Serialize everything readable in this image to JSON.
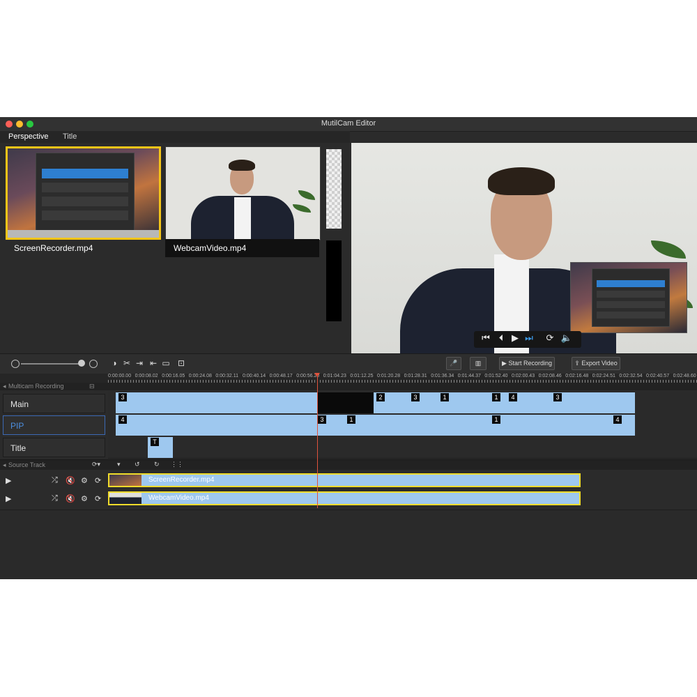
{
  "window": {
    "title": "MutilCam Editor"
  },
  "tabs": [
    {
      "label": "Perspective",
      "active": true
    },
    {
      "label": "Title",
      "active": false
    }
  ],
  "clips": [
    {
      "label": "ScreenRecorder.mp4",
      "selected": true
    },
    {
      "label": "WebcamVideo.mp4",
      "selected": false
    }
  ],
  "player": {
    "icons": [
      "skip-back-icon",
      "step-back-icon",
      "play-icon",
      "step-forward-icon",
      "loop-icon",
      "volume-icon"
    ]
  },
  "toolbar": {
    "tools": [
      "contrast-icon",
      "cut-icon",
      "split-left-icon",
      "split-right-icon",
      "crop-icon",
      "fit-icon"
    ],
    "start_recording_label": "Start Recording",
    "export_video_label": "Export Video"
  },
  "ruler": {
    "ticks": [
      "0:00:00.00",
      "0:00:08.02",
      "0:00:16.05",
      "0:00:24.08",
      "0:00:32.11",
      "0:00:40.14",
      "0:00:48.17",
      "0:00:56.20",
      "0:01:04.23",
      "0:01:12.25",
      "0:01:20.28",
      "0:01:28.31",
      "0:01:36.34",
      "0:01:44.37",
      "0:01:52.40",
      "0:02:00.43",
      "0:02:08.46",
      "0:02:16.48",
      "0:02:24.51",
      "0:02:32.54",
      "0:02:40.57",
      "0:02:48.60"
    ]
  },
  "multicam": {
    "header": "Multicam Recording",
    "tracks": [
      {
        "label": "Main",
        "markers": [
          "3",
          "2",
          "3",
          "1",
          "1",
          "4",
          "3"
        ]
      },
      {
        "label": "PIP",
        "markers": [
          "4",
          "3",
          "1",
          "1",
          "4"
        ]
      },
      {
        "label": "Title",
        "markers": [
          "T"
        ]
      }
    ]
  },
  "source_track": {
    "header": "Source Track",
    "items": [
      {
        "label": "ScreenRecorder.mp4"
      },
      {
        "label": "WebcamVideo.mp4"
      }
    ]
  },
  "colors": {
    "accent_yellow": "#f5c518",
    "clip_blue": "#9ec8ef",
    "playhead": "#e0523c",
    "pip_blue": "#4c8fe0"
  }
}
